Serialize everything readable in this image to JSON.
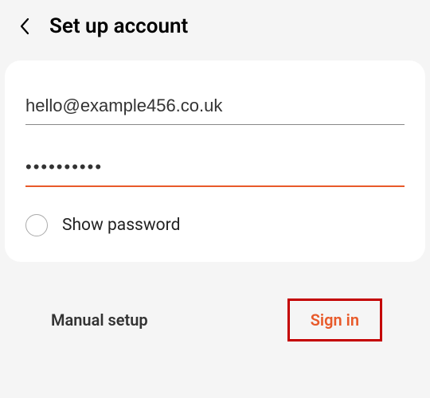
{
  "header": {
    "title": "Set up account"
  },
  "form": {
    "email_value": "hello@example456.co.uk",
    "password_value": "••••••••••",
    "show_password_label": "Show password"
  },
  "actions": {
    "manual_setup_label": "Manual setup",
    "sign_in_label": "Sign in"
  },
  "colors": {
    "accent": "#e85a2a",
    "highlight_border": "#c40000"
  }
}
